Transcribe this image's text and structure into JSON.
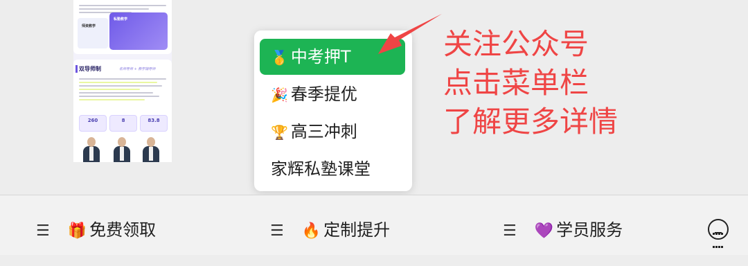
{
  "menu": {
    "items": [
      {
        "icon": "🥇",
        "label": "中考押T",
        "active": true
      },
      {
        "icon": "🎉",
        "label": "春季提优"
      },
      {
        "icon": "🏆",
        "label": "高三冲刺"
      },
      {
        "icon": "",
        "label": "家辉私塾课堂"
      }
    ]
  },
  "annotation": {
    "lines": [
      "关注公众号",
      "点击菜单栏",
      "了解更多详情"
    ],
    "color": "#ef4545"
  },
  "bottom_bar": {
    "tabs": [
      {
        "icon": "🎁",
        "label": "免费领取"
      },
      {
        "icon": "🔥",
        "label": "定制提升"
      },
      {
        "icon": "💜",
        "label": "学员服务"
      }
    ],
    "hamburger": "☰"
  },
  "thumbnail": {
    "card_title_left": "师资教学",
    "card_title_right": "私塾教学",
    "section_title": "双导师制",
    "section_subtitle": "名师导师 + 教学辅导师",
    "stats": [
      "260",
      "8",
      "83.8"
    ]
  },
  "colors": {
    "active_green": "#1db454",
    "accent_purple": "#6f5ae8"
  }
}
